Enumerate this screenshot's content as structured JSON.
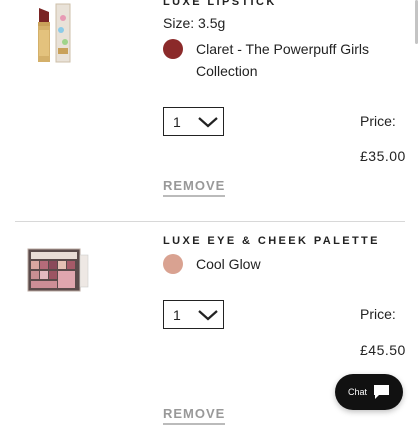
{
  "cart": {
    "items": [
      {
        "name": "LUXE LIPSTICK",
        "size": "Size: 3.5g",
        "shade": {
          "name_line1": "Claret - The Powerpuff Girls",
          "name_line2": "Collection",
          "color": "#8b2a2a"
        },
        "quantity": "1",
        "price_label": "Price:",
        "price": "£35.00",
        "remove_label": "REMOVE",
        "image_icon": "lipstick-product-image"
      },
      {
        "name": "LUXE EYE & CHEEK PALETTE",
        "shade": {
          "name": "Cool Glow",
          "color": "#d9a291"
        },
        "quantity": "1",
        "price_label": "Price:",
        "price": "£45.50",
        "remove_label": "REMOVE",
        "image_icon": "palette-product-image"
      }
    ]
  },
  "chat": {
    "label": "Chat",
    "icon": "chat-bubble-icon"
  },
  "colors": {
    "text": "#222222",
    "muted": "#999999",
    "divider": "#d8d8d8",
    "chat_bg": "#111111"
  }
}
